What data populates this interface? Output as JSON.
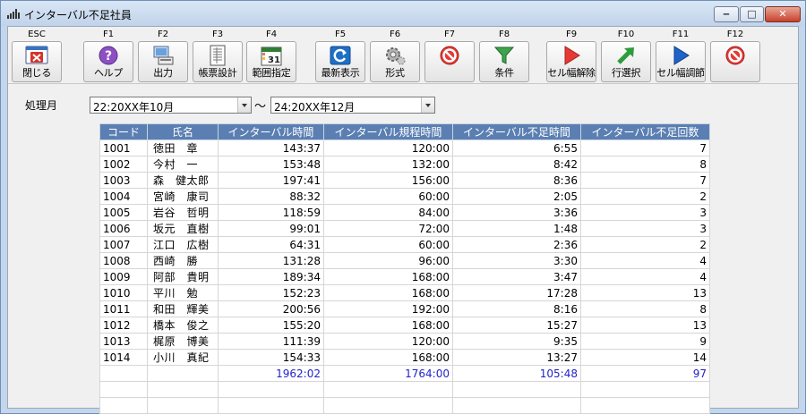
{
  "window": {
    "title": "インターバル不足社員",
    "controls": {
      "minimize": "‒",
      "maximize": "□",
      "close": "✕"
    }
  },
  "toolbar": [
    {
      "key": "ESC",
      "label": "閉じる",
      "icon": "close-window-icon"
    },
    {
      "key": "F1",
      "label": "ヘルプ",
      "icon": "help-icon"
    },
    {
      "key": "F2",
      "label": "出力",
      "icon": "output-icon"
    },
    {
      "key": "F3",
      "label": "帳票設計",
      "icon": "report-design-icon"
    },
    {
      "key": "F4",
      "label": "範囲指定",
      "icon": "calendar-icon"
    },
    {
      "key": "F5",
      "label": "最新表示",
      "icon": "refresh-icon"
    },
    {
      "key": "F6",
      "label": "形式",
      "icon": "gear-icon"
    },
    {
      "key": "F7",
      "label": "",
      "icon": "prohibited-icon"
    },
    {
      "key": "F8",
      "label": "条件",
      "icon": "filter-icon"
    },
    {
      "key": "F9",
      "label": "セル幅解除",
      "icon": "play-icon"
    },
    {
      "key": "F10",
      "label": "行選択",
      "icon": "arrow-up-right-icon"
    },
    {
      "key": "F11",
      "label": "セル幅調節",
      "icon": "play-blue-icon"
    },
    {
      "key": "F12",
      "label": "",
      "icon": "prohibited-icon"
    }
  ],
  "period": {
    "label": "処理月",
    "from": "22:20XX年10月",
    "separator": "～",
    "to": "24:20XX年12月"
  },
  "table": {
    "columns": [
      "コード",
      "氏名",
      "インターバル時間",
      "インターバル規程時間",
      "インターバル不足時間",
      "インターバル不足回数"
    ],
    "rows": [
      [
        "1001",
        "徳田　章",
        "143:37",
        "120:00",
        "6:55",
        "7"
      ],
      [
        "1002",
        "今村　一",
        "153:48",
        "132:00",
        "8:42",
        "8"
      ],
      [
        "1003",
        "森　健太郎",
        "197:41",
        "156:00",
        "8:36",
        "7"
      ],
      [
        "1004",
        "宮崎　康司",
        "88:32",
        "60:00",
        "2:05",
        "2"
      ],
      [
        "1005",
        "岩谷　哲明",
        "118:59",
        "84:00",
        "3:36",
        "3"
      ],
      [
        "1006",
        "坂元　直樹",
        "99:01",
        "72:00",
        "1:48",
        "3"
      ],
      [
        "1007",
        "江口　広樹",
        "64:31",
        "60:00",
        "2:36",
        "2"
      ],
      [
        "1008",
        "西崎　勝",
        "131:28",
        "96:00",
        "3:30",
        "4"
      ],
      [
        "1009",
        "阿部　貴明",
        "189:34",
        "168:00",
        "3:47",
        "4"
      ],
      [
        "1010",
        "平川　勉",
        "152:23",
        "168:00",
        "17:28",
        "13"
      ],
      [
        "1011",
        "和田　輝美",
        "200:56",
        "192:00",
        "8:16",
        "8"
      ],
      [
        "1012",
        "橋本　俊之",
        "155:20",
        "168:00",
        "15:27",
        "13"
      ],
      [
        "1013",
        "梶原　博美",
        "111:39",
        "120:00",
        "9:35",
        "9"
      ],
      [
        "1014",
        "小川　真紀",
        "154:33",
        "168:00",
        "13:27",
        "14"
      ]
    ],
    "totals": [
      "",
      "",
      "1962:02",
      "1764:00",
      "105:48",
      "97"
    ]
  },
  "colors": {
    "header_bg": "#5b7fb2",
    "total_text": "#2222cc"
  }
}
